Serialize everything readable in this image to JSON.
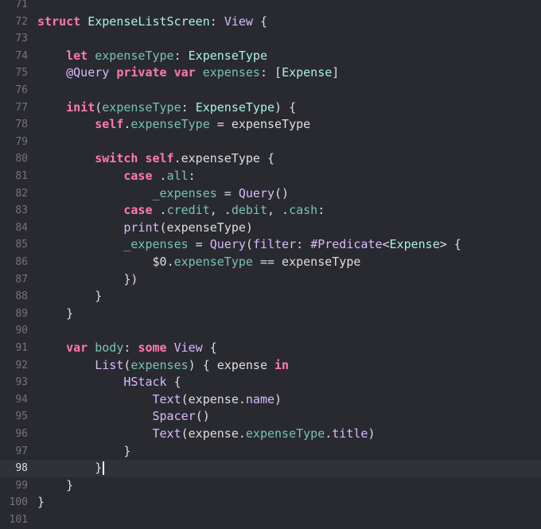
{
  "editor": {
    "current_line": "98",
    "lines": [
      {
        "num": "71",
        "tokens": []
      },
      {
        "num": "72",
        "tokens": [
          {
            "t": "struct",
            "c": "kw"
          },
          {
            "t": " "
          },
          {
            "t": "ExpenseListScreen",
            "c": "pt"
          },
          {
            "t": ": "
          },
          {
            "t": "View",
            "c": "ty"
          },
          {
            "t": " {"
          }
        ]
      },
      {
        "num": "73",
        "tokens": []
      },
      {
        "num": "74",
        "tokens": [
          {
            "t": "    "
          },
          {
            "t": "let",
            "c": "kw"
          },
          {
            "t": " "
          },
          {
            "t": "expenseType",
            "c": "pm"
          },
          {
            "t": ": "
          },
          {
            "t": "ExpenseType",
            "c": "pt"
          }
        ]
      },
      {
        "num": "75",
        "tokens": [
          {
            "t": "    "
          },
          {
            "t": "@Query",
            "c": "ty"
          },
          {
            "t": " "
          },
          {
            "t": "private",
            "c": "kw"
          },
          {
            "t": " "
          },
          {
            "t": "var",
            "c": "kw"
          },
          {
            "t": " "
          },
          {
            "t": "expenses",
            "c": "pm"
          },
          {
            "t": ": ["
          },
          {
            "t": "Expense",
            "c": "pt"
          },
          {
            "t": "]"
          }
        ]
      },
      {
        "num": "76",
        "tokens": []
      },
      {
        "num": "77",
        "tokens": [
          {
            "t": "    "
          },
          {
            "t": "init",
            "c": "kw"
          },
          {
            "t": "("
          },
          {
            "t": "expenseType",
            "c": "pm"
          },
          {
            "t": ": "
          },
          {
            "t": "ExpenseType",
            "c": "pt"
          },
          {
            "t": ") {"
          }
        ]
      },
      {
        "num": "78",
        "tokens": [
          {
            "t": "        "
          },
          {
            "t": "self",
            "c": "kw"
          },
          {
            "t": "."
          },
          {
            "t": "expenseType",
            "c": "pm"
          },
          {
            "t": " = expenseType"
          }
        ]
      },
      {
        "num": "79",
        "tokens": []
      },
      {
        "num": "80",
        "tokens": [
          {
            "t": "        "
          },
          {
            "t": "switch",
            "c": "kw"
          },
          {
            "t": " "
          },
          {
            "t": "self",
            "c": "kw"
          },
          {
            "t": ".expenseType {"
          }
        ]
      },
      {
        "num": "81",
        "tokens": [
          {
            "t": "            "
          },
          {
            "t": "case",
            "c": "kw"
          },
          {
            "t": " ."
          },
          {
            "t": "all",
            "c": "pm"
          },
          {
            "t": ":"
          }
        ]
      },
      {
        "num": "82",
        "tokens": [
          {
            "t": "                "
          },
          {
            "t": "_expenses",
            "c": "pm"
          },
          {
            "t": " = "
          },
          {
            "t": "Query",
            "c": "ty"
          },
          {
            "t": "()"
          }
        ]
      },
      {
        "num": "83",
        "tokens": [
          {
            "t": "            "
          },
          {
            "t": "case",
            "c": "kw"
          },
          {
            "t": " ."
          },
          {
            "t": "credit",
            "c": "pm"
          },
          {
            "t": ", ."
          },
          {
            "t": "debit",
            "c": "pm"
          },
          {
            "t": ", ."
          },
          {
            "t": "cash",
            "c": "pm"
          },
          {
            "t": ":"
          }
        ]
      },
      {
        "num": "84",
        "tokens": [
          {
            "t": "            "
          },
          {
            "t": "print",
            "c": "ty"
          },
          {
            "t": "(expenseType)"
          }
        ]
      },
      {
        "num": "85",
        "tokens": [
          {
            "t": "            "
          },
          {
            "t": "_expenses",
            "c": "pm"
          },
          {
            "t": " = "
          },
          {
            "t": "Query",
            "c": "ty"
          },
          {
            "t": "("
          },
          {
            "t": "filter",
            "c": "ty"
          },
          {
            "t": ": "
          },
          {
            "t": "#Predicate",
            "c": "ty"
          },
          {
            "t": "<"
          },
          {
            "t": "Expense",
            "c": "pt"
          },
          {
            "t": "> {"
          }
        ]
      },
      {
        "num": "86",
        "tokens": [
          {
            "t": "                "
          },
          {
            "t": "$0",
            "c": "pl"
          },
          {
            "t": "."
          },
          {
            "t": "expenseType",
            "c": "pm"
          },
          {
            "t": " == expenseType"
          }
        ]
      },
      {
        "num": "87",
        "tokens": [
          {
            "t": "            })"
          }
        ]
      },
      {
        "num": "88",
        "tokens": [
          {
            "t": "        }"
          }
        ]
      },
      {
        "num": "89",
        "tokens": [
          {
            "t": "    }"
          }
        ]
      },
      {
        "num": "90",
        "tokens": []
      },
      {
        "num": "91",
        "tokens": [
          {
            "t": "    "
          },
          {
            "t": "var",
            "c": "kw"
          },
          {
            "t": " "
          },
          {
            "t": "body",
            "c": "pm"
          },
          {
            "t": ": "
          },
          {
            "t": "some",
            "c": "kw"
          },
          {
            "t": " "
          },
          {
            "t": "View",
            "c": "ty"
          },
          {
            "t": " {"
          }
        ]
      },
      {
        "num": "92",
        "tokens": [
          {
            "t": "        "
          },
          {
            "t": "List",
            "c": "ty"
          },
          {
            "t": "("
          },
          {
            "t": "expenses",
            "c": "pm"
          },
          {
            "t": ") { expense "
          },
          {
            "t": "in",
            "c": "kw"
          }
        ]
      },
      {
        "num": "93",
        "tokens": [
          {
            "t": "            "
          },
          {
            "t": "HStack",
            "c": "ty"
          },
          {
            "t": " {"
          }
        ]
      },
      {
        "num": "94",
        "tokens": [
          {
            "t": "                "
          },
          {
            "t": "Text",
            "c": "ty"
          },
          {
            "t": "(expense."
          },
          {
            "t": "name",
            "c": "ty"
          },
          {
            "t": ")"
          }
        ]
      },
      {
        "num": "95",
        "tokens": [
          {
            "t": "                "
          },
          {
            "t": "Spacer",
            "c": "ty"
          },
          {
            "t": "()"
          }
        ]
      },
      {
        "num": "96",
        "tokens": [
          {
            "t": "                "
          },
          {
            "t": "Text",
            "c": "ty"
          },
          {
            "t": "(expense."
          },
          {
            "t": "expenseType",
            "c": "pm"
          },
          {
            "t": "."
          },
          {
            "t": "title",
            "c": "ty"
          },
          {
            "t": ")"
          }
        ]
      },
      {
        "num": "97",
        "tokens": [
          {
            "t": "            }"
          }
        ]
      },
      {
        "num": "98",
        "tokens": [
          {
            "t": "        }"
          }
        ]
      },
      {
        "num": "99",
        "tokens": [
          {
            "t": "    }"
          }
        ]
      },
      {
        "num": "100",
        "tokens": [
          {
            "t": "}"
          }
        ]
      },
      {
        "num": "101",
        "tokens": []
      }
    ]
  },
  "colors": {
    "background": "#292a30",
    "current_line": "#2f3239",
    "keyword": "#ff7ab2",
    "type_other": "#dabaff",
    "type_project": "#acf2e4",
    "property_project": "#78c2b3",
    "plain": "#dfdfe0",
    "line_number": "#747478"
  }
}
